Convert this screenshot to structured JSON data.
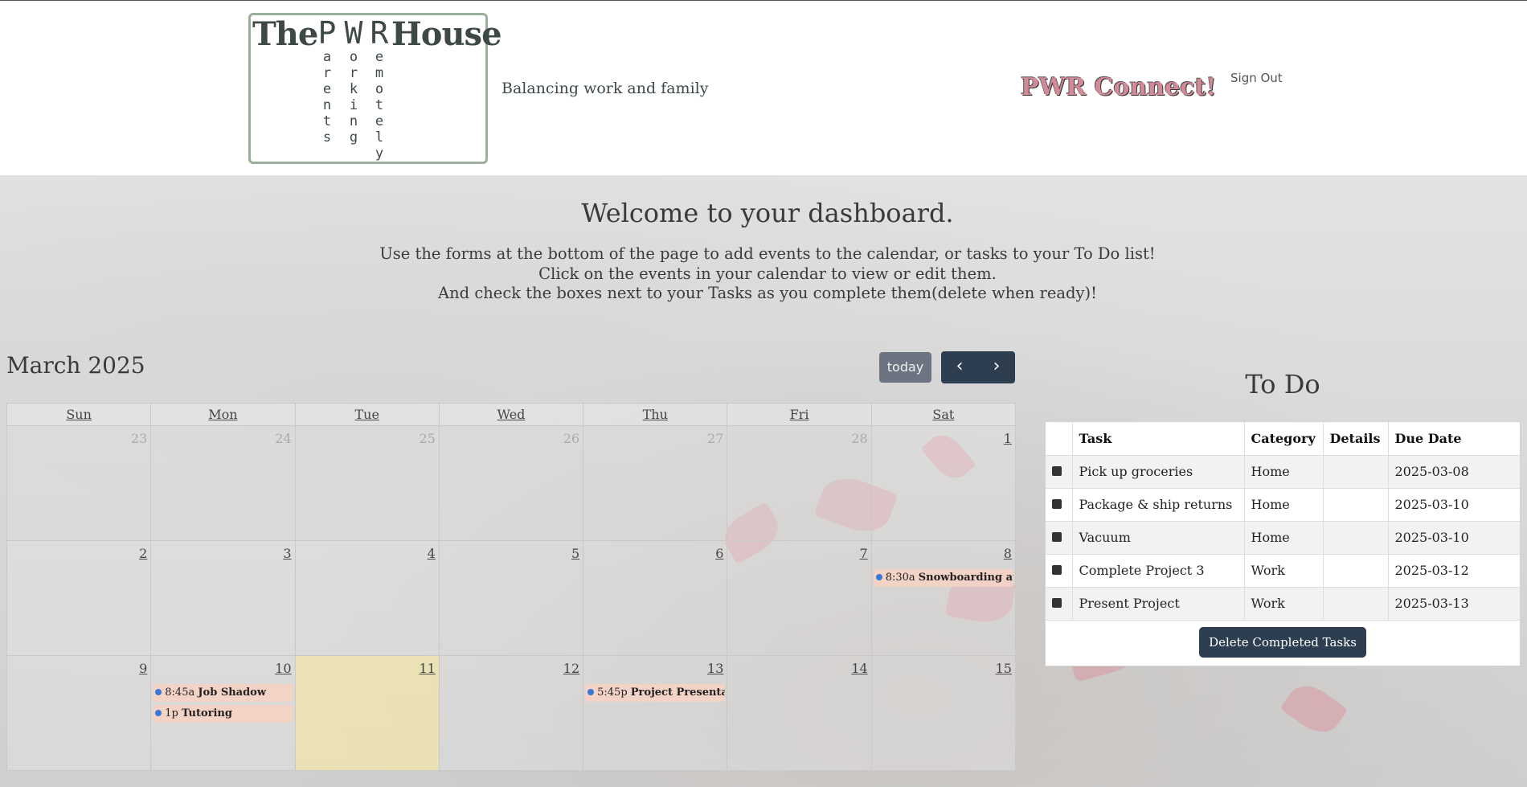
{
  "header": {
    "logo": {
      "the": "The",
      "house": "House",
      "columns": [
        {
          "big": "P",
          "letters": [
            "a",
            "r",
            "e",
            "n",
            "t",
            "s"
          ]
        },
        {
          "big": "W",
          "letters": [
            "o",
            "r",
            "k",
            "i",
            "n",
            "g"
          ]
        },
        {
          "big": "R",
          "letters": [
            "e",
            "m",
            "o",
            "t",
            "e",
            "l",
            "y"
          ]
        }
      ]
    },
    "tagline": "Balancing work and family",
    "connect_label": "PWR Connect!",
    "signout_label": "Sign Out"
  },
  "welcome": {
    "title": "Welcome to your dashboard.",
    "lines": [
      "Use the forms at the bottom of the page to add events to the calendar, or tasks to your To Do list!",
      "Click on the events in your calendar to view or edit them.",
      "And check the boxes next to your Tasks as you complete them(delete when ready)!"
    ]
  },
  "calendar": {
    "title": "March 2025",
    "today_label": "today",
    "prev_icon": "‹",
    "next_icon": "›",
    "day_names": [
      "Sun",
      "Mon",
      "Tue",
      "Wed",
      "Thu",
      "Fri",
      "Sat"
    ],
    "weeks": [
      [
        {
          "num": "23",
          "other": true
        },
        {
          "num": "24",
          "other": true
        },
        {
          "num": "25",
          "other": true
        },
        {
          "num": "26",
          "other": true
        },
        {
          "num": "27",
          "other": true
        },
        {
          "num": "28",
          "other": true
        },
        {
          "num": "1"
        }
      ],
      [
        {
          "num": "2"
        },
        {
          "num": "3"
        },
        {
          "num": "4"
        },
        {
          "num": "5"
        },
        {
          "num": "6"
        },
        {
          "num": "7"
        },
        {
          "num": "8",
          "events": [
            {
              "time": "8:30a",
              "title": "Snowboarding at"
            }
          ]
        }
      ],
      [
        {
          "num": "9"
        },
        {
          "num": "10",
          "events": [
            {
              "time": "8:45a",
              "title": "Job Shadow"
            },
            {
              "time": "1p",
              "title": "Tutoring"
            }
          ]
        },
        {
          "num": "11",
          "today": true
        },
        {
          "num": "12"
        },
        {
          "num": "13",
          "events": [
            {
              "time": "5:45p",
              "title": "Project Presentat"
            }
          ]
        },
        {
          "num": "14"
        },
        {
          "num": "15"
        }
      ]
    ]
  },
  "todo": {
    "title": "To Do",
    "columns": [
      "Task",
      "Category",
      "Details",
      "Due Date"
    ],
    "rows": [
      {
        "task": "Pick up groceries",
        "category": "Home",
        "details": "",
        "due": "2025-03-08"
      },
      {
        "task": "Package & ship returns",
        "category": "Home",
        "details": "",
        "due": "2025-03-10"
      },
      {
        "task": "Vacuum",
        "category": "Home",
        "details": "",
        "due": "2025-03-10"
      },
      {
        "task": "Complete Project 3",
        "category": "Work",
        "details": "",
        "due": "2025-03-12"
      },
      {
        "task": "Present Project",
        "category": "Work",
        "details": "",
        "due": "2025-03-13"
      }
    ],
    "delete_label": "Delete Completed Tasks"
  }
}
